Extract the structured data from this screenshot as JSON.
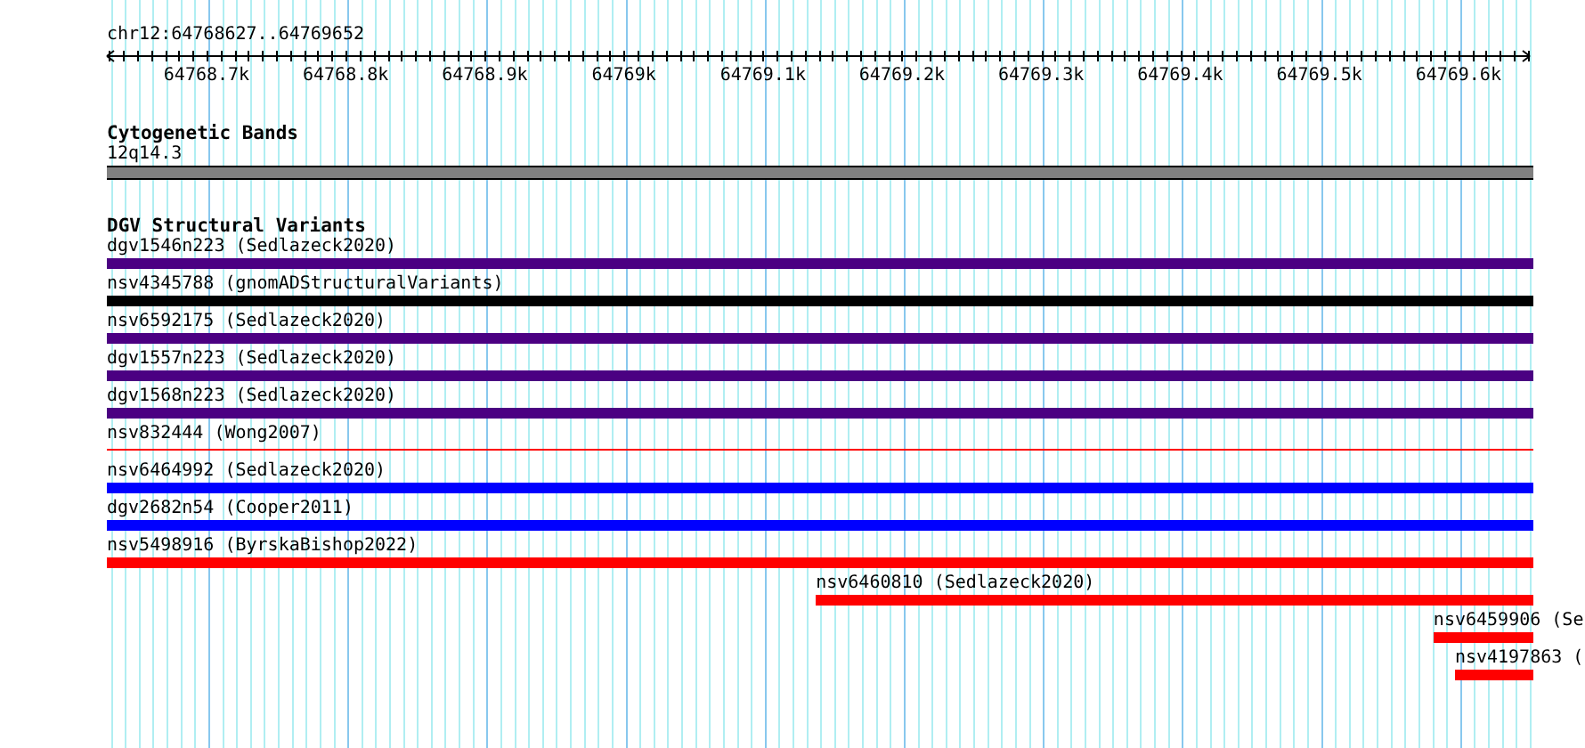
{
  "ruler": {
    "location": "chr12:64768627..64769652",
    "tick_labels": [
      "64768.7k",
      "64768.8k",
      "64768.9k",
      "64769k",
      "64769.1k",
      "64769.2k",
      "64769.3k",
      "64769.4k",
      "64769.5k",
      "64769.6k"
    ]
  },
  "tracks": [
    {
      "title": "Cytogenetic Bands",
      "features": [
        {
          "label": "12q14.3",
          "kind": "band",
          "color": "#808080",
          "level": 1
        }
      ]
    },
    {
      "title": "DGV Structural Variants",
      "features": [
        {
          "label": "dgv1546n223 (Sedlazeck2020)",
          "kind": "bar",
          "color": "#4b0082",
          "level": 1
        },
        {
          "label": "nsv4345788 (gnomADStructuralVariants)",
          "kind": "bar",
          "color": "#000000",
          "level": 1
        },
        {
          "label": "nsv6592175 (Sedlazeck2020)",
          "kind": "bar",
          "color": "#4b0082",
          "level": 1
        },
        {
          "label": "dgv1557n223 (Sedlazeck2020)",
          "kind": "bar",
          "color": "#4b0082",
          "level": 1
        },
        {
          "label": "dgv1568n223 (Sedlazeck2020)",
          "kind": "bar",
          "color": "#4b0082",
          "level": 1
        },
        {
          "label": "nsv832444 (Wong2007)",
          "kind": "line",
          "color": "#ff0000",
          "level": 1
        },
        {
          "label": "nsv6464992 (Sedlazeck2020)",
          "kind": "bar",
          "color": "#0000ff",
          "level": 1
        },
        {
          "label": "dgv2682n54 (Cooper2011)",
          "kind": "bar",
          "color": "#0000ff",
          "level": 1
        },
        {
          "label": "nsv5498916 (ByrskaBishop2022)",
          "kind": "bar",
          "color": "#ff0000",
          "level": 1
        },
        {
          "label": "nsv6460810 (Sedlazeck2020)",
          "kind": "bar",
          "color": "#ff0000",
          "level": 0.503
        },
        {
          "label": "nsv6459906 (Se",
          "kind": "bar",
          "color": "#ff0000",
          "level": 0.07
        },
        {
          "label": "nsv4197863 (",
          "kind": "bar",
          "color": "#ff0000",
          "level": 0.055
        }
      ]
    }
  ]
}
